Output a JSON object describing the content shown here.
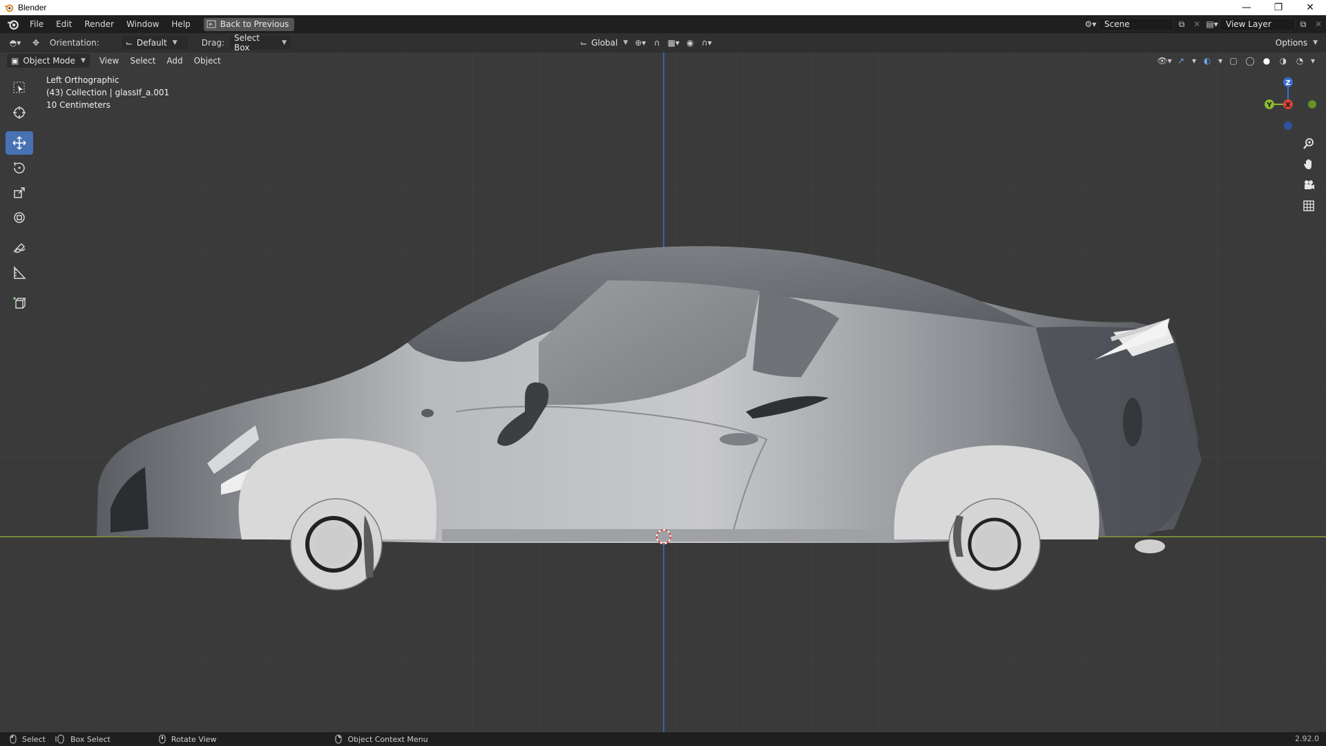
{
  "window": {
    "title": "Blender",
    "controls": [
      "minimize",
      "restore",
      "close"
    ]
  },
  "menubar": {
    "items": [
      "File",
      "Edit",
      "Render",
      "Window",
      "Help"
    ],
    "back_button": "Back to Previous",
    "scene": "Scene",
    "view_layer": "View Layer"
  },
  "toolheader": {
    "orientation_label": "Orientation:",
    "orientation_value": "Default",
    "drag_label": "Drag:",
    "drag_value": "Select Box",
    "transform_orientation": "Global",
    "options_label": "Options"
  },
  "viewport_header": {
    "mode": "Object Mode",
    "menus": [
      "View",
      "Select",
      "Add",
      "Object"
    ]
  },
  "viewport": {
    "view_name": "Left Orthographic",
    "collection_info": "(43) Collection | glassIf_a.001",
    "scale_info": "10 Centimeters",
    "axes": {
      "z": "Z",
      "y": "Y",
      "x": "X"
    },
    "colors": {
      "background": "#3a3a3a",
      "grid": "#474747",
      "x_axis": "#9fbf3b",
      "z_axis": "#3b6fd6",
      "active_tool": "#4772b3"
    }
  },
  "left_tools": [
    "select-box-icon",
    "cursor-icon",
    "move-icon",
    "rotate-icon",
    "scale-icon",
    "transform-icon",
    "annotate-icon",
    "measure-icon",
    "add-cube-icon"
  ],
  "nav_tools": [
    "zoom-icon",
    "hand-pan-icon",
    "camera-icon",
    "grid-icon"
  ],
  "statusbar": {
    "select": "Select",
    "box_select": "Box Select",
    "rotate_view": "Rotate View",
    "context_menu": "Object Context Menu",
    "version": "2.92.0"
  }
}
